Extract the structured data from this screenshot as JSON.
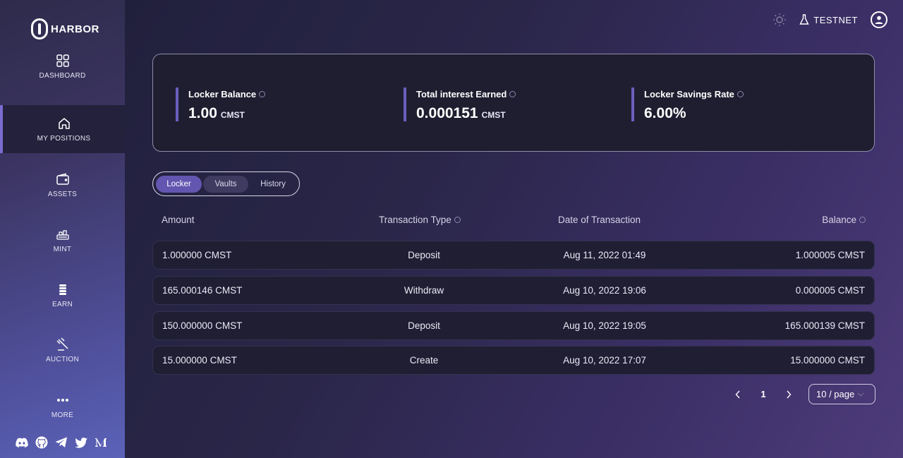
{
  "app": {
    "logo_text": "HARBOR",
    "network_label": "TESTNET"
  },
  "sidebar": {
    "items": [
      {
        "label": "DASHBOARD",
        "icon": "grid-icon"
      },
      {
        "label": "MY POSITIONS",
        "icon": "home-icon",
        "active": true
      },
      {
        "label": "ASSETS",
        "icon": "wallet-icon"
      },
      {
        "label": "MINT",
        "icon": "mint-icon"
      },
      {
        "label": "EARN",
        "icon": "coins-icon"
      },
      {
        "label": "AUCTION",
        "icon": "gavel-icon"
      },
      {
        "label": "MORE",
        "icon": "more-icon"
      }
    ],
    "socials": [
      "discord-icon",
      "github-icon",
      "telegram-icon",
      "twitter-icon",
      "medium-icon"
    ]
  },
  "stats": [
    {
      "title": "Locker Balance",
      "value": "1.00",
      "unit": "CMST"
    },
    {
      "title": "Total interest Earned",
      "value": "0.000151",
      "unit": "CMST"
    },
    {
      "title": "Locker Savings Rate",
      "value": "6.00%",
      "unit": ""
    }
  ],
  "tabs": [
    "Locker",
    "Vaults",
    "History"
  ],
  "table": {
    "headers": [
      "Amount",
      "Transaction Type",
      "Date of Transaction",
      "Balance"
    ],
    "rows": [
      {
        "amount": "1.000000 CMST",
        "type": "Deposit",
        "date": "Aug 11, 2022 01:49",
        "balance": "1.000005 CMST"
      },
      {
        "amount": "165.000146 CMST",
        "type": "Withdraw",
        "date": "Aug 10, 2022 19:06",
        "balance": "0.000005 CMST"
      },
      {
        "amount": "150.000000 CMST",
        "type": "Deposit",
        "date": "Aug 10, 2022 19:05",
        "balance": "165.000139 CMST"
      },
      {
        "amount": "15.000000 CMST",
        "type": "Create",
        "date": "Aug 10, 2022 17:07",
        "balance": "15.000000 CMST"
      }
    ]
  },
  "pagination": {
    "current_page": "1",
    "page_size": "10 / page"
  },
  "colors": {
    "accent": "#6256b0",
    "card_bg": "#1f1e30"
  }
}
